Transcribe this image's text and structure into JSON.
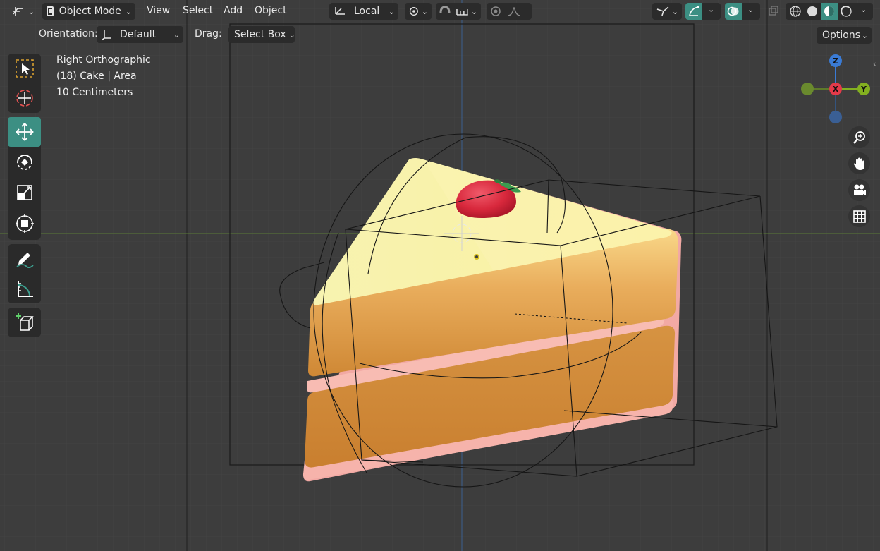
{
  "header": {
    "editor_type_icon": "view3d-icon",
    "mode_label": "Object Mode",
    "menus": [
      "View",
      "Select",
      "Add",
      "Object"
    ],
    "pivot_label": "Local",
    "orientation_label": "Orientation:",
    "orientation_value": "Default",
    "drag_label": "Drag:",
    "drag_value": "Select Box",
    "options_label": "Options"
  },
  "viewport": {
    "view_name": "Right Orthographic",
    "object_info": "(18) Cake | Area",
    "scale_info": "10 Centimeters"
  },
  "gizmo": {
    "z_label": "Z",
    "x_label": "X",
    "y_label": "Y"
  },
  "colors": {
    "accent": "#3c8f83",
    "x_axis": "#e33a4a",
    "y_axis": "#83b020",
    "z_axis": "#3a7bd5",
    "background": "#3d3d3d",
    "grid": "#4a4a4a"
  },
  "tools": [
    "select-box-icon",
    "cursor-icon",
    "move-icon",
    "rotate-icon",
    "scale-icon",
    "transform-icon",
    "annotate-icon",
    "measure-icon",
    "add-cube-icon"
  ],
  "nav_buttons": [
    "zoom-icon",
    "pan-hand-icon",
    "camera-icon",
    "grid-toggle-icon"
  ]
}
